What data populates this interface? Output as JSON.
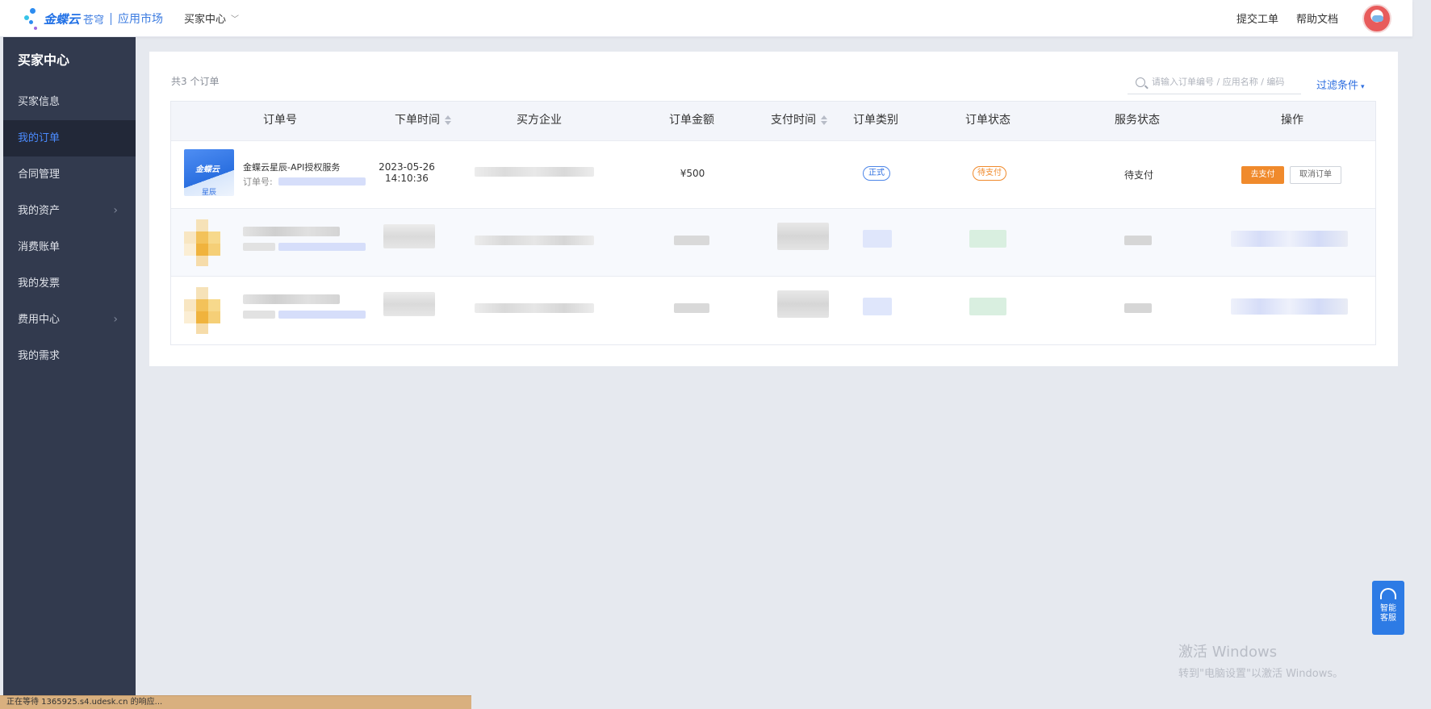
{
  "header": {
    "brand_name": "金蝶云",
    "brand_sub": "苍穹",
    "brand_market": "应用市场",
    "center_menu": "买家中心",
    "links": [
      "提交工单",
      "帮助文档"
    ],
    "brand_colors": {
      "blue": "#1f6fe5",
      "dot1": "#2d8cf0",
      "dot2": "#36c3e8",
      "dot3": "#a06ae0"
    }
  },
  "sidebar": {
    "title": "买家中心",
    "items": [
      {
        "label": "买家信息",
        "active": false,
        "has_arrow": false
      },
      {
        "label": "我的订单",
        "active": true,
        "has_arrow": false
      },
      {
        "label": "合同管理",
        "active": false,
        "has_arrow": false
      },
      {
        "label": "我的资产",
        "active": false,
        "has_arrow": true
      },
      {
        "label": "消费账单",
        "active": false,
        "has_arrow": false
      },
      {
        "label": "我的发票",
        "active": false,
        "has_arrow": false
      },
      {
        "label": "费用中心",
        "active": false,
        "has_arrow": true
      },
      {
        "label": "我的需求",
        "active": false,
        "has_arrow": false
      }
    ],
    "arrow_glyph": "›"
  },
  "orders": {
    "count_text": "共3 个订单",
    "search_placeholder": "请输入订单编号 / 应用名称 / 编码",
    "filter_label": "过滤条件",
    "filter_icon": "▾",
    "columns": [
      "订单号",
      "下单时间",
      "买方企业",
      "订单金额",
      "支付时间",
      "订单类别",
      "订单状态",
      "服务状态",
      "操作"
    ],
    "sortable_columns": [
      "下单时间",
      "支付时间"
    ],
    "rows": [
      {
        "thumb_brand": "金蝶云",
        "thumb_sub": "星辰",
        "product_name": "金蝶云星辰-API授权服务",
        "order_no_label": "订单号:",
        "date": "2023-05-26",
        "time": "14:10:36",
        "amount": "¥500",
        "type": "正式",
        "status": "待支付",
        "service_status": "待支付",
        "actions": [
          "去支付",
          "取消订单"
        ]
      }
    ]
  },
  "float_service": {
    "label_line1": "智能",
    "label_line2": "客服"
  },
  "watermark": {
    "line1": "激活 Windows",
    "line2": "转到\"电脑设置\"以激活 Windows。"
  },
  "statusbar_text": "正在等待 1365925.s4.udesk.cn 的响应..."
}
